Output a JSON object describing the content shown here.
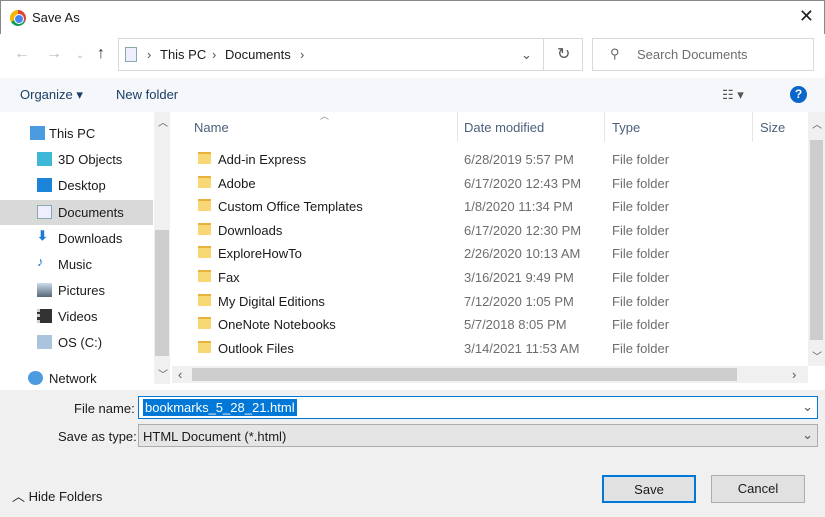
{
  "window": {
    "title": "Save As"
  },
  "address": {
    "crumbs": [
      "This PC",
      "Documents"
    ]
  },
  "search": {
    "placeholder": "Search Documents"
  },
  "toolbar": {
    "organize": "Organize",
    "new_folder": "New folder",
    "help": "?"
  },
  "nav": {
    "items": [
      {
        "label": "This PC",
        "icon": "computer-icon"
      },
      {
        "label": "3D Objects",
        "icon": "cube-icon"
      },
      {
        "label": "Desktop",
        "icon": "desktop-icon"
      },
      {
        "label": "Documents",
        "icon": "document-icon",
        "selected": true
      },
      {
        "label": "Downloads",
        "icon": "download-icon"
      },
      {
        "label": "Music",
        "icon": "music-icon"
      },
      {
        "label": "Pictures",
        "icon": "picture-icon"
      },
      {
        "label": "Videos",
        "icon": "video-icon"
      },
      {
        "label": "OS (C:)",
        "icon": "drive-icon"
      },
      {
        "label": "Network",
        "icon": "network-icon"
      }
    ]
  },
  "columns": {
    "name": "Name",
    "date": "Date modified",
    "type": "Type",
    "size": "Size"
  },
  "files": [
    {
      "name": "Add-in Express",
      "date": "6/28/2019 5:57 PM",
      "type": "File folder"
    },
    {
      "name": "Adobe",
      "date": "6/17/2020 12:43 PM",
      "type": "File folder"
    },
    {
      "name": "Custom Office Templates",
      "date": "1/8/2020 11:34 PM",
      "type": "File folder"
    },
    {
      "name": "Downloads",
      "date": "6/17/2020 12:30 PM",
      "type": "File folder"
    },
    {
      "name": "ExploreHowTo",
      "date": "2/26/2020 10:13 AM",
      "type": "File folder"
    },
    {
      "name": "Fax",
      "date": "3/16/2021 9:49 PM",
      "type": "File folder"
    },
    {
      "name": "My Digital Editions",
      "date": "7/12/2020 1:05 PM",
      "type": "File folder"
    },
    {
      "name": "OneNote Notebooks",
      "date": "5/7/2018 8:05 PM",
      "type": "File folder"
    },
    {
      "name": "Outlook Files",
      "date": "3/14/2021 11:53 AM",
      "type": "File folder"
    }
  ],
  "form": {
    "file_name_label": "File name:",
    "file_name": "bookmarks_5_28_21.html",
    "type_label": "Save as type:",
    "type_value": "HTML Document (*.html)"
  },
  "footer": {
    "hide_folders": "Hide Folders",
    "save": "Save",
    "cancel": "Cancel"
  }
}
